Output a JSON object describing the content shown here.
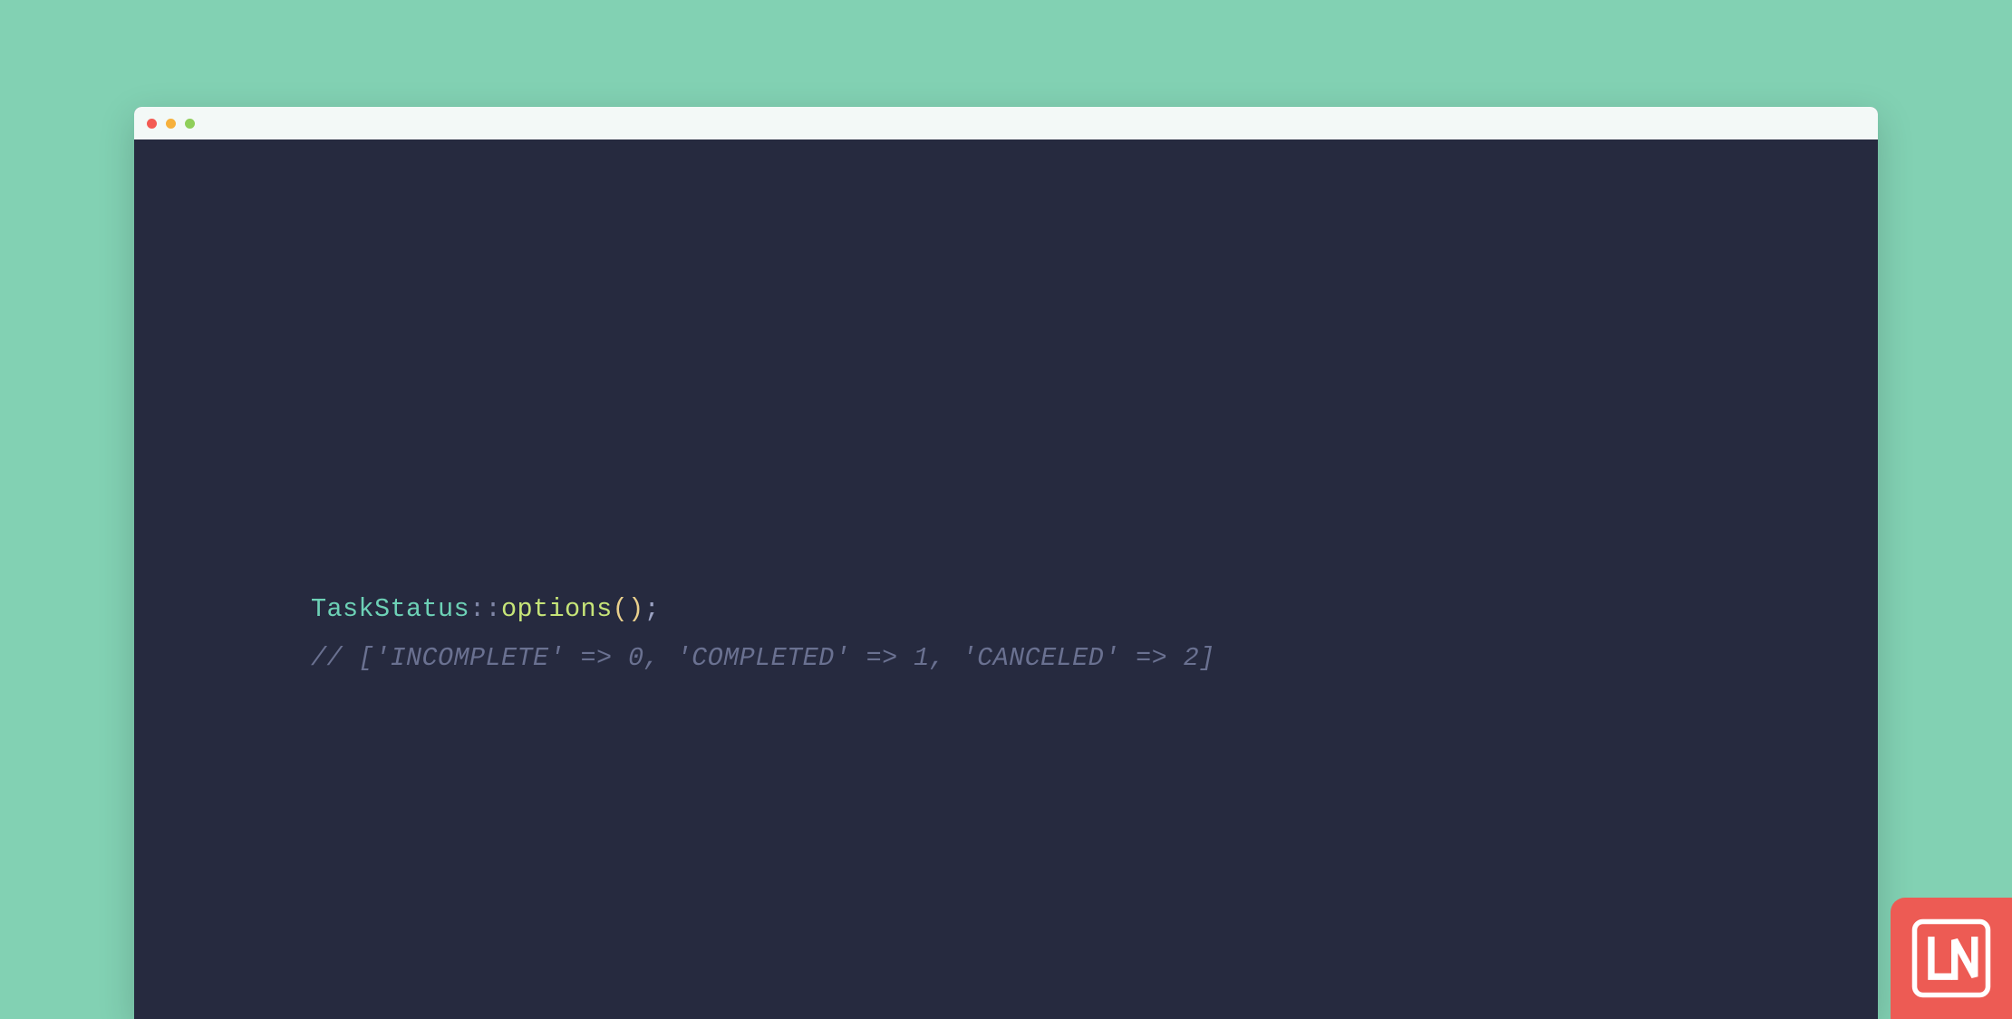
{
  "colors": {
    "page_bg": "#82d1b3",
    "titlebar_bg": "#f3f9f7",
    "editor_bg": "#262a3f",
    "logo_bg": "#ed5b54",
    "dot_red": "#f35b53",
    "dot_yellow": "#f6b13c",
    "dot_green": "#8fcf5a",
    "tok_class": "#6dd1b6",
    "tok_scope": "#7f86a6",
    "tok_method": "#c6e478",
    "tok_paren": "#e9d08c",
    "tok_punc": "#9ba2c2",
    "tok_comment": "#6a7191"
  },
  "code": {
    "line1": {
      "class_name": "TaskStatus",
      "scope_operator": "::",
      "method_name": "options",
      "paren_open": "(",
      "paren_close": ")",
      "terminator": ";"
    },
    "line2_comment": "// ['INCOMPLETE' => 0, 'COMPLETED' => 1, 'CANCELED' => 2]"
  },
  "traffic_lights": [
    "close",
    "minimize",
    "zoom"
  ],
  "logo_text": "LN"
}
